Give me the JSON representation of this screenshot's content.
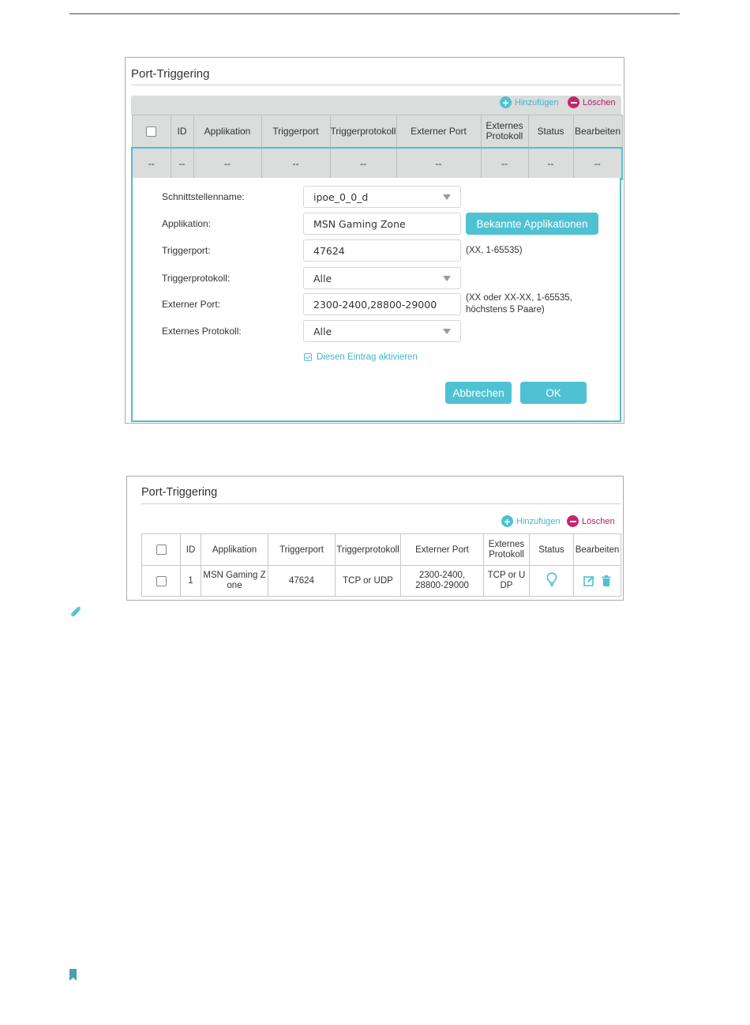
{
  "panel1": {
    "title": "Port-Triggering",
    "add_label": "Hinzufügen",
    "delete_label": "Löschen",
    "columns": [
      "",
      "ID",
      "Applikation",
      "Triggerport",
      "Triggerprotokoll",
      "Externer Port",
      "Externes Protokoll",
      "Status",
      "Bearbeiten"
    ],
    "empty_row": [
      "--",
      "--",
      "--",
      "--",
      "--",
      "--",
      "--",
      "--",
      "--"
    ],
    "form": {
      "interface_label": "Schnittstellenname:",
      "interface_value": "ipoe_0_0_d",
      "application_label": "Applikation:",
      "application_value": "MSN Gaming Zone",
      "known_apps_button": "Bekannte Applikationen",
      "trigger_port_label": "Triggerport:",
      "trigger_port_value": "47624",
      "trigger_port_hint": "(XX, 1-65535)",
      "trigger_protocol_label": "Triggerprotokoll:",
      "trigger_protocol_value": "Alle",
      "external_port_label": "Externer Port:",
      "external_port_value": "2300-2400,28800-29000",
      "external_port_hint_1": "(XX oder XX-XX, 1-65535,",
      "external_port_hint_2": "höchstens 5 Paare)",
      "external_protocol_label": "Externes Protokoll:",
      "external_protocol_value": "Alle",
      "enable_label": "Diesen Eintrag aktivieren",
      "enable_checked": true,
      "cancel_button": "Abbrechen",
      "ok_button": "OK"
    }
  },
  "panel2": {
    "title": "Port-Triggering",
    "add_label": "Hinzufügen",
    "delete_label": "Löschen",
    "columns": [
      "",
      "ID",
      "Applikation",
      "Triggerport",
      "Triggerprotokoll",
      "Externer Port",
      "Externes Protokoll",
      "Status",
      "Bearbeiten"
    ],
    "row": {
      "id": "1",
      "application_1": "MSN Gaming Z",
      "application_2": "one",
      "trigger_port": "47624",
      "trigger_protocol": "TCP or UDP",
      "external_port_1": "2300-2400,",
      "external_port_2": "28800-29000",
      "external_protocol_1": "TCP or U",
      "external_protocol_2": "DP",
      "status_icon": "lightbulb-icon",
      "edit_icon": "edit-icon",
      "delete_icon": "trash-icon"
    }
  },
  "icons": {
    "note": "paperclip-icon",
    "footer": "bookmark-icon"
  },
  "colors": {
    "accent": "#4ec1d2",
    "delete": "#c2286b",
    "header_bg": "#dbdcdc"
  }
}
